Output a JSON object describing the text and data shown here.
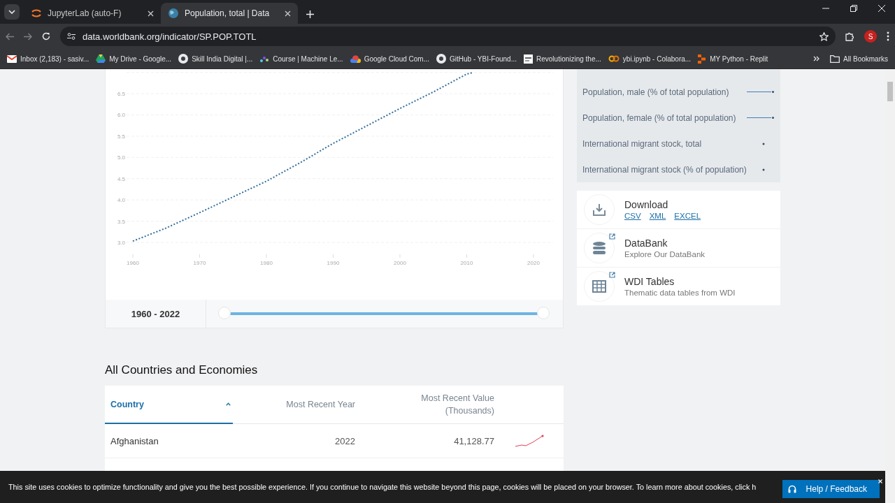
{
  "browser": {
    "tabs": [
      {
        "title": "JupyterLab (auto-F)",
        "kind": "arcs",
        "selected": false
      },
      {
        "title": "Population, total | Data",
        "kind": "globe",
        "selected": true
      }
    ],
    "address": "data.worldbank.org/indicator/SP.POP.TOTL",
    "profile_initial": "S",
    "bookmarks": [
      {
        "label": "Inbox (2,183) - sasiv...",
        "kind": "envelope"
      },
      {
        "label": "My Drive - Google...",
        "kind": "triangle"
      },
      {
        "label": "Skill India Digital |...",
        "kind": "circle"
      },
      {
        "label": "Course | Machine Le...",
        "kind": "dots"
      },
      {
        "label": "Google Cloud Com...",
        "kind": "cloud"
      },
      {
        "label": "GitHub - YBI-Found...",
        "kind": "circle"
      },
      {
        "label": "Revolutionizing the...",
        "kind": "square"
      },
      {
        "label": "ybi.ipynb - Colabora...",
        "kind": "rings"
      },
      {
        "label": "MY Python - Replit",
        "kind": "blocks"
      }
    ],
    "all_bookmarks": "All Bookmarks"
  },
  "chart": {
    "chart_data": {
      "type": "line",
      "x": [
        1960,
        1965,
        1970,
        1975,
        1980,
        1985,
        1990,
        1995,
        2000,
        2005,
        2010,
        2011
      ],
      "series": [
        {
          "color": "#2f6d9c",
          "line_style": "dotted",
          "values": [
            3.03,
            3.34,
            3.7,
            4.07,
            4.44,
            4.87,
            5.33,
            5.74,
            6.15,
            6.54,
            6.96,
            7.0
          ]
        }
      ],
      "xlim": [
        1960,
        2020
      ],
      "ylim": [
        3.0,
        7.0
      ],
      "grid": true,
      "xticks": [
        1960,
        1970,
        1980,
        1990,
        2000,
        2010,
        2020
      ],
      "yticks": [
        {
          "value": 3,
          "label": "3.0"
        },
        {
          "value": 3.5,
          "label": "3.5"
        },
        {
          "value": 4,
          "label": "4.0"
        },
        {
          "value": 4.5,
          "label": "4.5"
        },
        {
          "value": 5,
          "label": "5.0"
        },
        {
          "value": 5.5,
          "label": "5.5"
        },
        {
          "value": 6,
          "label": "6.0"
        },
        {
          "value": 6.5,
          "label": "6.5"
        }
      ]
    },
    "year_range": "1960 - 2022",
    "range_slider": {
      "level": 1
    }
  },
  "related": [
    {
      "label": "Population, male (% of total population)",
      "kind": "line"
    },
    {
      "label": "Population, female (% of total population)",
      "kind": "line"
    },
    {
      "label": "International migrant stock, total",
      "kind": "dot"
    },
    {
      "label": "International migrant stock (% of population)",
      "kind": "dot"
    }
  ],
  "resources": [
    {
      "kind": "download",
      "title": "Download",
      "links": [
        "CSV",
        "XML",
        "EXCEL"
      ]
    },
    {
      "kind": "database",
      "title": "DataBank",
      "subtitle": "Explore Our DataBank"
    },
    {
      "kind": "table",
      "title": "WDI Tables",
      "subtitle": "Thematic data tables from WDI"
    }
  ],
  "section_title": "All Countries and Economies",
  "table": {
    "columns": [
      {
        "label": "Country",
        "selected": true
      },
      {
        "label": "Most Recent Year",
        "selected": false
      },
      {
        "label": "Most Recent Value (Thousands)",
        "selected": false
      }
    ],
    "rows": [
      {
        "country": "Afghanistan",
        "year": "2022",
        "value": "41,128.77"
      }
    ]
  },
  "cookie_notice": {
    "text": "This site uses cookies to optimize functionality and give you the best possible experience. If you continue to navigate this website beyond this page, cookies will be placed on your browser. To learn more about cookies, click h"
  },
  "help_button": "Help / Feedback"
}
